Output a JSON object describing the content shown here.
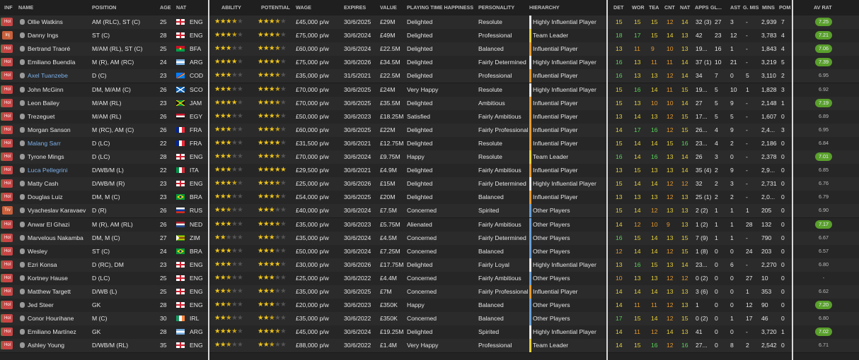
{
  "columns": {
    "inf": "INF",
    "name": "NAME",
    "position": "POSITION",
    "age": "AGE",
    "nat": "NAT",
    "ability": "ABILITY",
    "potential": "POTENTIAL",
    "wage": "WAGE",
    "expires": "EXPIRES",
    "value": "VALUE",
    "happiness": "PLAYING TIME HAPPINESS",
    "personality": "PERSONALITY",
    "hierarchy": "HIERARCHY",
    "det": "DET",
    "wor": "WOR",
    "tea": "TEA",
    "cnt": "CNT",
    "natn": "NAT",
    "apps": "APPS",
    "gls": "GL...",
    "ast": "AST",
    "gmis": "G. MIS",
    "mins": "MINS",
    "pom": "POM",
    "avrat": "AV RAT"
  },
  "colors": {
    "green": "#5ad45a",
    "yellow": "#e8d13a",
    "orange": "#e69a2e",
    "rating_badge": "#5aa02c",
    "link": "#7cb0e8"
  },
  "players": [
    {
      "inf": "Hol",
      "name": "Ollie Watkins",
      "link": false,
      "position": "AM (RLC), ST (C)",
      "age": "25",
      "nat": "ENG",
      "ability": 3.5,
      "potential": 3.5,
      "wage": "£45,000 p/w",
      "expires": "30/6/2025",
      "value": "£29M",
      "happiness": "Delighted",
      "personality": "Resolute",
      "hierarchy": "Highly Influential Player",
      "hcolor": "#e8e8e8",
      "det": "15",
      "wor": "15",
      "tea": "15",
      "cnt": "12",
      "natn": "14",
      "apps": "32 (3)",
      "gls": "27",
      "ast": "3",
      "gmis": "-",
      "mins": "2,939",
      "pom": "7",
      "avrat": "7.25",
      "hi": true
    },
    {
      "inf": "Inj",
      "name": "Danny Ings",
      "link": false,
      "position": "ST (C)",
      "age": "28",
      "nat": "ENG",
      "ability": 3.5,
      "potential": 3.5,
      "wage": "£75,000 p/w",
      "expires": "30/6/2024",
      "value": "£49M",
      "happiness": "Delighted",
      "personality": "Professional",
      "hierarchy": "Team Leader",
      "hcolor": "#e8d13a",
      "det": "18",
      "wor": "17",
      "tea": "15",
      "cnt": "14",
      "natn": "13",
      "apps": "42",
      "gls": "23",
      "ast": "12",
      "gmis": "-",
      "mins": "3,783",
      "pom": "4",
      "avrat": "7.21",
      "hi": true
    },
    {
      "inf": "Hol",
      "name": "Bertrand Traoré",
      "link": false,
      "position": "M/AM (RL), ST (C)",
      "age": "25",
      "nat": "BFA",
      "ability": 3,
      "potential": 3.5,
      "wage": "£60,000 p/w",
      "expires": "30/6/2024",
      "value": "£22.5M",
      "happiness": "Delighted",
      "personality": "Balanced",
      "hierarchy": "Influential Player",
      "hcolor": "#e69a2e",
      "det": "13",
      "wor": "11",
      "tea": "9",
      "cnt": "10",
      "natn": "13",
      "apps": "19...",
      "gls": "16",
      "ast": "1",
      "gmis": "-",
      "mins": "1,843",
      "pom": "4",
      "avrat": "7.06",
      "hi": true
    },
    {
      "inf": "Hol",
      "name": "Emiliano Buendía",
      "link": false,
      "position": "M (R), AM (RC)",
      "age": "24",
      "nat": "ARG",
      "ability": 4,
      "potential": 4,
      "wage": "£75,000 p/w",
      "expires": "30/6/2026",
      "value": "£34.5M",
      "happiness": "Delighted",
      "personality": "Fairly Determined",
      "hierarchy": "Highly Influential Player",
      "hcolor": "#e8e8e8",
      "det": "16",
      "wor": "13",
      "tea": "11",
      "cnt": "11",
      "natn": "14",
      "apps": "37 (1)",
      "gls": "10",
      "ast": "21",
      "gmis": "-",
      "mins": "3,219",
      "pom": "5",
      "avrat": "7.39",
      "hi": true
    },
    {
      "inf": "Hol",
      "name": "Axel Tuanzebe",
      "link": true,
      "position": "D (C)",
      "age": "23",
      "nat": "COD",
      "ability": 3,
      "potential": 3.5,
      "wage": "£35,000 p/w",
      "expires": "31/5/2021",
      "value": "£22.5M",
      "happiness": "Delighted",
      "personality": "Professional",
      "hierarchy": "Influential Player",
      "hcolor": "#e69a2e",
      "det": "16",
      "wor": "13",
      "tea": "13",
      "cnt": "12",
      "natn": "14",
      "apps": "34",
      "gls": "7",
      "ast": "0",
      "gmis": "5",
      "mins": "3,110",
      "pom": "2",
      "avrat": "6.95",
      "hi": false
    },
    {
      "inf": "Hol",
      "name": "John McGinn",
      "link": false,
      "position": "DM, M/AM (C)",
      "age": "26",
      "nat": "SCO",
      "ability": 3,
      "potential": 3.5,
      "wage": "£70,000 p/w",
      "expires": "30/6/2025",
      "value": "£24M",
      "happiness": "Very Happy",
      "personality": "Resolute",
      "hierarchy": "Highly Influential Player",
      "hcolor": "#e8e8e8",
      "det": "15",
      "wor": "16",
      "tea": "14",
      "cnt": "11",
      "natn": "15",
      "apps": "19...",
      "gls": "5",
      "ast": "10",
      "gmis": "1",
      "mins": "1,828",
      "pom": "3",
      "avrat": "6.92",
      "hi": false
    },
    {
      "inf": "Hol",
      "name": "Leon Bailey",
      "link": false,
      "position": "M/AM (RL)",
      "age": "23",
      "nat": "JAM",
      "ability": 4,
      "potential": 3.5,
      "wage": "£70,000 p/w",
      "expires": "30/6/2025",
      "value": "£35.5M",
      "happiness": "Delighted",
      "personality": "Ambitious",
      "hierarchy": "Influential Player",
      "hcolor": "#e69a2e",
      "det": "15",
      "wor": "13",
      "tea": "10",
      "cnt": "10",
      "natn": "14",
      "apps": "27",
      "gls": "5",
      "ast": "9",
      "gmis": "-",
      "mins": "2,148",
      "pom": "1",
      "avrat": "7.19",
      "hi": true
    },
    {
      "inf": "Hol",
      "name": "Trezeguet",
      "link": false,
      "position": "M/AM (RL)",
      "age": "26",
      "nat": "EGY",
      "ability": 3,
      "potential": 3.5,
      "wage": "£50,000 p/w",
      "expires": "30/6/2023",
      "value": "£18.25M",
      "happiness": "Satisfied",
      "personality": "Fairly Ambitious",
      "hierarchy": "Influential Player",
      "hcolor": "#e69a2e",
      "det": "13",
      "wor": "14",
      "tea": "13",
      "cnt": "12",
      "natn": "15",
      "apps": "17...",
      "gls": "5",
      "ast": "5",
      "gmis": "-",
      "mins": "1,607",
      "pom": "0",
      "avrat": "6.89",
      "hi": false
    },
    {
      "inf": "Hol",
      "name": "Morgan Sanson",
      "link": false,
      "position": "M (RC), AM (C)",
      "age": "26",
      "nat": "FRA",
      "ability": 3,
      "potential": 3.5,
      "wage": "£60,000 p/w",
      "expires": "30/6/2025",
      "value": "£22M",
      "happiness": "Delighted",
      "personality": "Fairly Professional",
      "hierarchy": "Influential Player",
      "hcolor": "#e69a2e",
      "det": "14",
      "wor": "17",
      "tea": "16",
      "cnt": "12",
      "natn": "15",
      "apps": "26...",
      "gls": "4",
      "ast": "9",
      "gmis": "-",
      "mins": "2,4...",
      "pom": "3",
      "avrat": "6.95",
      "hi": false
    },
    {
      "inf": "Hol",
      "name": "Malang Sarr",
      "link": true,
      "position": "D (LC)",
      "age": "22",
      "nat": "FRA",
      "ability": 3,
      "potential": 4,
      "wage": "£31,500 p/w",
      "expires": "30/6/2021",
      "value": "£12.75M",
      "happiness": "Delighted",
      "personality": "Resolute",
      "hierarchy": "Influential Player",
      "hcolor": "#e69a2e",
      "det": "15",
      "wor": "14",
      "tea": "14",
      "cnt": "15",
      "natn": "16",
      "apps": "23...",
      "gls": "4",
      "ast": "2",
      "gmis": "-",
      "mins": "2,186",
      "pom": "0",
      "avrat": "6.84",
      "hi": false
    },
    {
      "inf": "Hol",
      "name": "Tyrone Mings",
      "link": false,
      "position": "D (LC)",
      "age": "28",
      "nat": "ENG",
      "ability": 3,
      "potential": 3.5,
      "wage": "£70,000 p/w",
      "expires": "30/6/2024",
      "value": "£9.75M",
      "happiness": "Happy",
      "personality": "Resolute",
      "hierarchy": "Team Leader",
      "hcolor": "#e8d13a",
      "det": "16",
      "wor": "14",
      "tea": "16",
      "cnt": "13",
      "natn": "14",
      "apps": "26",
      "gls": "3",
      "ast": "0",
      "gmis": "-",
      "mins": "2,378",
      "pom": "0",
      "avrat": "7.01",
      "hi": true
    },
    {
      "inf": "Hol",
      "name": "Luca Pellegrini",
      "link": true,
      "position": "D/WB/M (L)",
      "age": "22",
      "nat": "ITA",
      "ability": 3,
      "potential": 5,
      "wage": "£29,500 p/w",
      "expires": "30/6/2021",
      "value": "£4.9M",
      "happiness": "Delighted",
      "personality": "Fairly Ambitious",
      "hierarchy": "Influential Player",
      "hcolor": "#e69a2e",
      "det": "13",
      "wor": "15",
      "tea": "13",
      "cnt": "13",
      "natn": "14",
      "apps": "35 (4)",
      "gls": "2",
      "ast": "9",
      "gmis": "-",
      "mins": "2,9...",
      "pom": "0",
      "avrat": "6.85",
      "hi": false
    },
    {
      "inf": "Hol",
      "name": "Matty Cash",
      "link": false,
      "position": "D/WB/M (R)",
      "age": "23",
      "nat": "ENG",
      "ability": 3.5,
      "potential": 3.5,
      "wage": "£25,000 p/w",
      "expires": "30/6/2026",
      "value": "£15M",
      "happiness": "Delighted",
      "personality": "Fairly Determined",
      "hierarchy": "Highly Influential Player",
      "hcolor": "#e8e8e8",
      "det": "15",
      "wor": "14",
      "tea": "14",
      "cnt": "12",
      "natn": "12",
      "apps": "32",
      "gls": "2",
      "ast": "3",
      "gmis": "-",
      "mins": "2,731",
      "pom": "0",
      "avrat": "6.76",
      "hi": false
    },
    {
      "inf": "Hol",
      "name": "Douglas Luiz",
      "link": false,
      "position": "DM, M (C)",
      "age": "23",
      "nat": "BRA",
      "ability": 3,
      "potential": 3.5,
      "wage": "£54,000 p/w",
      "expires": "30/6/2025",
      "value": "£20M",
      "happiness": "Delighted",
      "personality": "Balanced",
      "hierarchy": "Influential Player",
      "hcolor": "#e69a2e",
      "det": "13",
      "wor": "13",
      "tea": "13",
      "cnt": "12",
      "natn": "13",
      "apps": "25 (1)",
      "gls": "2",
      "ast": "2",
      "gmis": "-",
      "mins": "2,0...",
      "pom": "0",
      "avrat": "6.79",
      "hi": false
    },
    {
      "inf": "Trv",
      "name": "Vyacheslav Karavaev",
      "link": false,
      "position": "D (R)",
      "age": "26",
      "nat": "RUS",
      "ability": 2.5,
      "potential": 3,
      "wage": "£40,000 p/w",
      "expires": "30/6/2024",
      "value": "£7.5M",
      "happiness": "Concerned",
      "personality": "Spirited",
      "hierarchy": "Other Players",
      "hcolor": "#6a9fd6",
      "det": "15",
      "wor": "14",
      "tea": "12",
      "cnt": "13",
      "natn": "13",
      "apps": "2 (2)",
      "gls": "1",
      "ast": "1",
      "gmis": "1",
      "mins": "205",
      "pom": "0",
      "avrat": "6.90",
      "hi": false
    },
    {
      "inf": "Hol",
      "name": "Anwar El Ghazi",
      "link": false,
      "position": "M (R), AM (RL)",
      "age": "26",
      "nat": "NED",
      "ability": 3,
      "potential": 3.5,
      "wage": "£35,000 p/w",
      "expires": "30/6/2023",
      "value": "£5.75M",
      "happiness": "Alienated",
      "personality": "Fairly Ambitious",
      "hierarchy": "Other Players",
      "hcolor": "#6a9fd6",
      "det": "14",
      "wor": "12",
      "tea": "10",
      "cnt": "9",
      "natn": "13",
      "apps": "1 (2)",
      "gls": "1",
      "ast": "1",
      "gmis": "28",
      "mins": "132",
      "pom": "0",
      "avrat": "7.17",
      "hi": true
    },
    {
      "inf": "Hol",
      "name": "Marvelous Nakamba",
      "link": false,
      "position": "DM, M (C)",
      "age": "27",
      "nat": "ZIM",
      "ability": 2,
      "potential": 3,
      "wage": "£35,000 p/w",
      "expires": "30/6/2024",
      "value": "£4.5M",
      "happiness": "Concerned",
      "personality": "Fairly Determined",
      "hierarchy": "Other Players",
      "hcolor": "#6a9fd6",
      "det": "16",
      "wor": "15",
      "tea": "14",
      "cnt": "13",
      "natn": "15",
      "apps": "7 (9)",
      "gls": "1",
      "ast": "1",
      "gmis": "-",
      "mins": "790",
      "pom": "0",
      "avrat": "6.67",
      "hi": false
    },
    {
      "inf": "Hol",
      "name": "Wesley",
      "link": false,
      "position": "ST (C)",
      "age": "24",
      "nat": "BRA",
      "ability": 3,
      "potential": 3,
      "wage": "£50,000 p/w",
      "expires": "30/6/2024",
      "value": "£7.25M",
      "happiness": "Concerned",
      "personality": "Balanced",
      "hierarchy": "Other Players",
      "hcolor": "#6a9fd6",
      "det": "12",
      "wor": "14",
      "tea": "14",
      "cnt": "12",
      "natn": "15",
      "apps": "1 (8)",
      "gls": "0",
      "ast": "0",
      "gmis": "24",
      "mins": "203",
      "pom": "0",
      "avrat": "6.57",
      "hi": false
    },
    {
      "inf": "Hol",
      "name": "Ezri Konsa",
      "link": false,
      "position": "D (RC), DM",
      "age": "23",
      "nat": "ENG",
      "ability": 3,
      "potential": 4,
      "wage": "£30,000 p/w",
      "expires": "30/6/2026",
      "value": "£17.75M",
      "happiness": "Delighted",
      "personality": "Fairly Loyal",
      "hierarchy": "Highly Influential Player",
      "hcolor": "#e8e8e8",
      "det": "13",
      "wor": "16",
      "tea": "15",
      "cnt": "13",
      "natn": "14",
      "apps": "23...",
      "gls": "0",
      "ast": "6",
      "gmis": "-",
      "mins": "2,270",
      "pom": "0",
      "avrat": "6.80",
      "hi": false
    },
    {
      "inf": "Hol",
      "name": "Kortney Hause",
      "link": false,
      "position": "D (LC)",
      "age": "25",
      "nat": "ENG",
      "ability": 2.5,
      "potential": 3,
      "wage": "£25,000 p/w",
      "expires": "30/6/2022",
      "value": "£4.4M",
      "happiness": "Concerned",
      "personality": "Fairly Ambitious",
      "hierarchy": "Other Players",
      "hcolor": "#6a9fd6",
      "det": "10",
      "wor": "13",
      "tea": "13",
      "cnt": "12",
      "natn": "12",
      "apps": "0 (2)",
      "gls": "0",
      "ast": "0",
      "gmis": "27",
      "mins": "10",
      "pom": "0",
      "avrat": "-",
      "hi": false
    },
    {
      "inf": "Hol",
      "name": "Matthew Targett",
      "link": false,
      "position": "D/WB (L)",
      "age": "25",
      "nat": "ENG",
      "ability": 2.5,
      "potential": 3,
      "wage": "£35,000 p/w",
      "expires": "30/6/2025",
      "value": "£7M",
      "happiness": "Concerned",
      "personality": "Fairly Professional",
      "hierarchy": "Influential Player",
      "hcolor": "#e69a2e",
      "det": "14",
      "wor": "14",
      "tea": "14",
      "cnt": "13",
      "natn": "13",
      "apps": "3 (6)",
      "gls": "0",
      "ast": "0",
      "gmis": "1",
      "mins": "353",
      "pom": "0",
      "avrat": "6.62",
      "hi": false
    },
    {
      "inf": "Hol",
      "name": "Jed Steer",
      "link": false,
      "position": "GK",
      "age": "28",
      "nat": "ENG",
      "ability": 2.5,
      "potential": 3,
      "wage": "£20,000 p/w",
      "expires": "30/6/2023",
      "value": "£350K",
      "happiness": "Happy",
      "personality": "Balanced",
      "hierarchy": "Other Players",
      "hcolor": "#6a9fd6",
      "det": "14",
      "wor": "11",
      "tea": "11",
      "cnt": "12",
      "natn": "13",
      "apps": "1",
      "gls": "0",
      "ast": "0",
      "gmis": "12",
      "mins": "90",
      "pom": "0",
      "avrat": "7.20",
      "hi": true
    },
    {
      "inf": "Hol",
      "name": "Conor Hourihane",
      "link": false,
      "position": "M (C)",
      "age": "30",
      "nat": "IRL",
      "ability": 2.5,
      "potential": 2.5,
      "wage": "£35,000 p/w",
      "expires": "30/6/2022",
      "value": "£350K",
      "happiness": "Concerned",
      "personality": "Balanced",
      "hierarchy": "Other Players",
      "hcolor": "#6a9fd6",
      "det": "17",
      "wor": "15",
      "tea": "14",
      "cnt": "12",
      "natn": "15",
      "apps": "0 (2)",
      "gls": "0",
      "ast": "1",
      "gmis": "17",
      "mins": "46",
      "pom": "0",
      "avrat": "6.80",
      "hi": false
    },
    {
      "inf": "Hol",
      "name": "Emiliano Martínez",
      "link": false,
      "position": "GK",
      "age": "28",
      "nat": "ARG",
      "ability": 3.5,
      "potential": 3.5,
      "wage": "£45,000 p/w",
      "expires": "30/6/2024",
      "value": "£19.25M",
      "happiness": "Delighted",
      "personality": "Spirited",
      "hierarchy": "Highly Influential Player",
      "hcolor": "#e8e8e8",
      "det": "14",
      "wor": "11",
      "tea": "12",
      "cnt": "14",
      "natn": "13",
      "apps": "41",
      "gls": "0",
      "ast": "0",
      "gmis": "-",
      "mins": "3,720",
      "pom": "1",
      "avrat": "7.02",
      "hi": true
    },
    {
      "inf": "Hol",
      "name": "Ashley Young",
      "link": false,
      "position": "D/WB/M (RL)",
      "age": "35",
      "nat": "ENG",
      "ability": 2.5,
      "potential": 2.5,
      "wage": "£88,000 p/w",
      "expires": "30/6/2022",
      "value": "£1.4M",
      "happiness": "Very Happy",
      "personality": "Professional",
      "hierarchy": "Team Leader",
      "hcolor": "#e8d13a",
      "det": "14",
      "wor": "15",
      "tea": "16",
      "cnt": "12",
      "natn": "16",
      "apps": "27...",
      "gls": "0",
      "ast": "8",
      "gmis": "2",
      "mins": "2,542",
      "pom": "0",
      "avrat": "6.71",
      "hi": false
    }
  ]
}
